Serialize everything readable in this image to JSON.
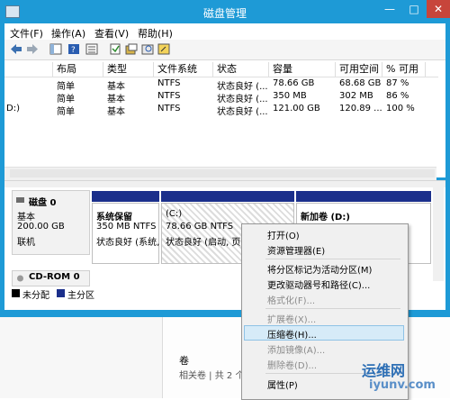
{
  "window": {
    "title": "磁盘管理",
    "controls": {
      "minimize": "—",
      "maximize": "□",
      "close": "✕"
    }
  },
  "menu": [
    "文件(F)",
    "操作(A)",
    "查看(V)",
    "帮助(H)"
  ],
  "volume_list": {
    "headers": [
      "布局",
      "类型",
      "文件系统",
      "状态",
      "容量",
      "可用空间",
      "% 可用"
    ],
    "rows": [
      {
        "name": "",
        "layout": "简单",
        "type": "基本",
        "fs": "NTFS",
        "status": "状态良好 (...",
        "capacity": "78.66 GB",
        "free": "68.68 GB",
        "pct": "87 %"
      },
      {
        "name": "",
        "layout": "简单",
        "type": "基本",
        "fs": "NTFS",
        "status": "状态良好 (...",
        "capacity": "350 MB",
        "free": "302 MB",
        "pct": "86 %"
      },
      {
        "name": "D:)",
        "layout": "简单",
        "type": "基本",
        "fs": "NTFS",
        "status": "状态良好 (...",
        "capacity": "121.00 GB",
        "free": "120.89 ...",
        "pct": "100 %"
      }
    ]
  },
  "disk0": {
    "name": "磁盘 0",
    "type": "基本",
    "size": "200.00 GB",
    "state": "联机"
  },
  "partitions": [
    {
      "title": "系统保留",
      "line1": "350 MB NTFS",
      "line2": "状态良好 (系统,"
    },
    {
      "title": "(C:)",
      "line1": "78.66 GB NTFS",
      "line2": "状态良好 (启动, 页面"
    },
    {
      "title": "新加卷  (D:)",
      "line1": "",
      "line2": ""
    }
  ],
  "cdrom": {
    "name": "CD-ROM 0"
  },
  "legend": {
    "unallocated": "未分配",
    "primary": "主分区",
    "colors": {
      "unallocated": "#000000",
      "primary": "#1b2f8b"
    }
  },
  "lower": {
    "title": "卷",
    "subtitle": "相关卷 | 共 2 个"
  },
  "context_menu": {
    "items": [
      {
        "label": "打开(O)",
        "enabled": true
      },
      {
        "label": "资源管理器(E)",
        "enabled": true
      },
      {
        "label": "将分区标记为活动分区(M)",
        "enabled": true
      },
      {
        "label": "更改驱动器号和路径(C)...",
        "enabled": true
      },
      {
        "label": "格式化(F)...",
        "enabled": false
      },
      {
        "label": "扩展卷(X)...",
        "enabled": false
      },
      {
        "label": "压缩卷(H)...",
        "enabled": true,
        "highlighted": true
      },
      {
        "label": "添加镜像(A)...",
        "enabled": false
      },
      {
        "label": "删除卷(D)...",
        "enabled": false
      },
      {
        "label": "属性(P)",
        "enabled": true
      }
    ]
  },
  "watermark": {
    "brand": "运维网",
    "url": "iyunv.com"
  },
  "colors": {
    "accent": "#1e9ad6",
    "close": "#c7453b",
    "partition_bar": "#1b2f8b",
    "highlight": "#d6ebf8"
  },
  "icons": [
    "back-arrow-icon",
    "forward-arrow-icon",
    "console-icon",
    "help-icon",
    "list-icon",
    "settings-icon",
    "properties-icon",
    "search-icon",
    "refresh-icon"
  ]
}
